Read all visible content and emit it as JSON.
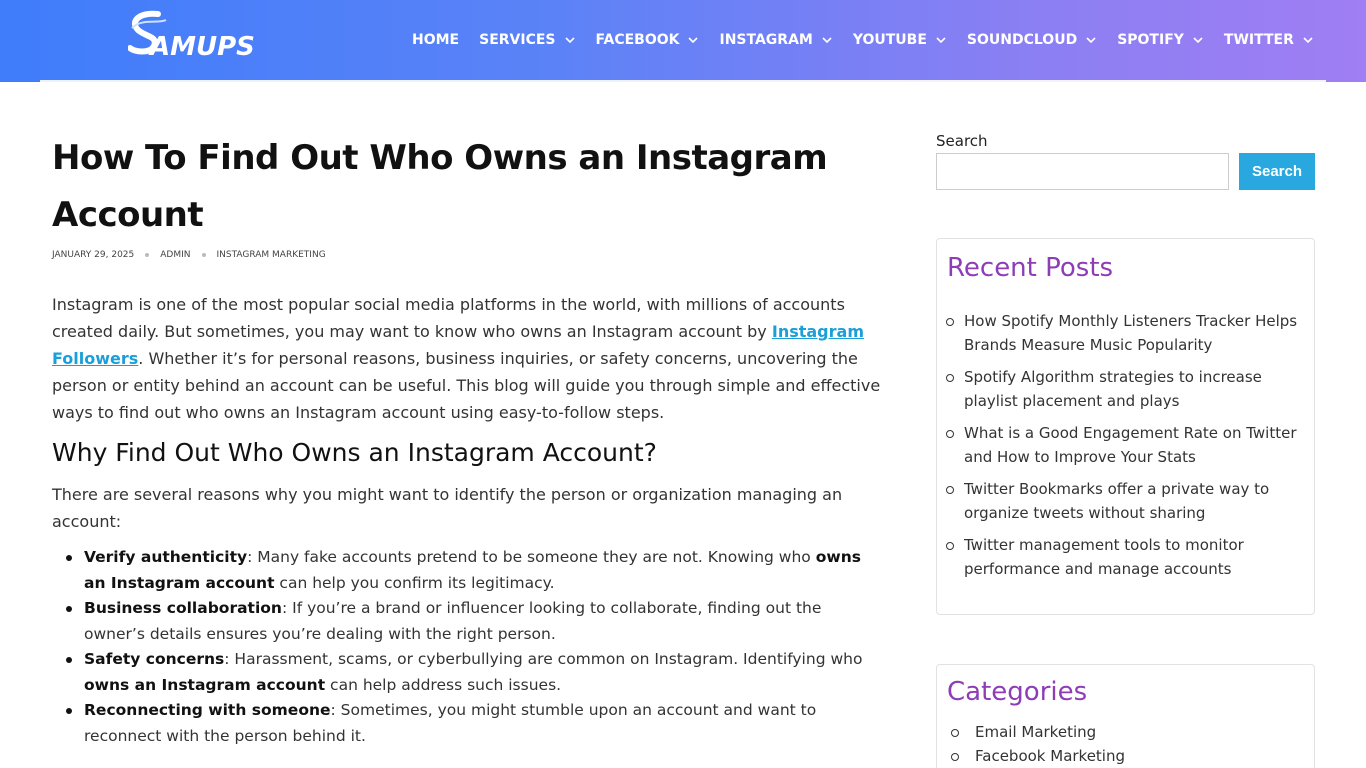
{
  "brand": {
    "logo_text": "AMUPS",
    "logo_icon": "s-swoosh-logo"
  },
  "nav": {
    "items": [
      {
        "label": "HOME",
        "has_dropdown": false
      },
      {
        "label": "SERVICES",
        "has_dropdown": true
      },
      {
        "label": "FACEBOOK",
        "has_dropdown": true
      },
      {
        "label": "INSTAGRAM",
        "has_dropdown": true
      },
      {
        "label": "YOUTUBE",
        "has_dropdown": true
      },
      {
        "label": "SOUNDCLOUD",
        "has_dropdown": true
      },
      {
        "label": "SPOTIFY",
        "has_dropdown": true
      },
      {
        "label": "TWITTER",
        "has_dropdown": true
      }
    ]
  },
  "article": {
    "title": "How To Find Out Who Owns an Instagram Account",
    "date": "JANUARY 29, 2025",
    "author": "ADMIN",
    "category": "INSTAGRAM MARKETING",
    "intro_before": "Instagram is one of the most popular social media platforms in the world, with millions of accounts created daily. But sometimes, you may want to know who owns an Instagram account by ",
    "intro_link": "Instagram Followers",
    "intro_after": ". Whether it’s for personal reasons, business inquiries, or safety concerns, uncovering the person or entity behind an account can be useful. This blog will guide you through simple and effective ways to find out who owns an Instagram account using easy-to-follow steps.",
    "section_heading": "Why Find Out Who Owns an Instagram Account?",
    "section_intro": "There are several reasons why you might want to identify the person or organization managing an account:",
    "bullets": [
      {
        "bold": "Verify authenticity",
        "text1": ": Many fake accounts pretend to be someone they are not. Knowing who ",
        "bold2": "owns an Instagram account",
        "text2": " can help you confirm its legitimacy."
      },
      {
        "bold": "Business collaboration",
        "text1": ": If you’re a brand or influencer looking to collaborate, finding out the owner’s details ensures you’re dealing with the right person.",
        "bold2": "",
        "text2": ""
      },
      {
        "bold": "Safety concerns",
        "text1": ": Harassment, scams, or cyberbullying are common on Instagram. Identifying who ",
        "bold2": "owns an Instagram account",
        "text2": " can help address such issues."
      },
      {
        "bold": "Reconnecting with someone",
        "text1": ": Sometimes, you might stumble upon an account and want to reconnect with the person behind it.",
        "bold2": "",
        "text2": ""
      }
    ]
  },
  "sidebar": {
    "search_label": "Search",
    "search_value": "",
    "search_button": "Search",
    "recent_title": "Recent Posts",
    "recent_posts": [
      "How Spotify Monthly Listeners Tracker Helps Brands Measure Music Popularity",
      "Spotify Algorithm strategies to increase playlist placement and plays",
      "What is a Good Engagement Rate on Twitter and How to Improve Your Stats",
      "Twitter Bookmarks offer a private way to organize tweets without sharing",
      "Twitter management tools to monitor performance and manage accounts"
    ],
    "categories_title": "Categories",
    "categories": [
      "Email Marketing",
      "Facebook Marketing"
    ]
  },
  "colors": {
    "accent": "#29a8e0",
    "widget_title": "#8e3db7",
    "header_start": "#3f7dfb",
    "header_end": "#a07ef3"
  }
}
